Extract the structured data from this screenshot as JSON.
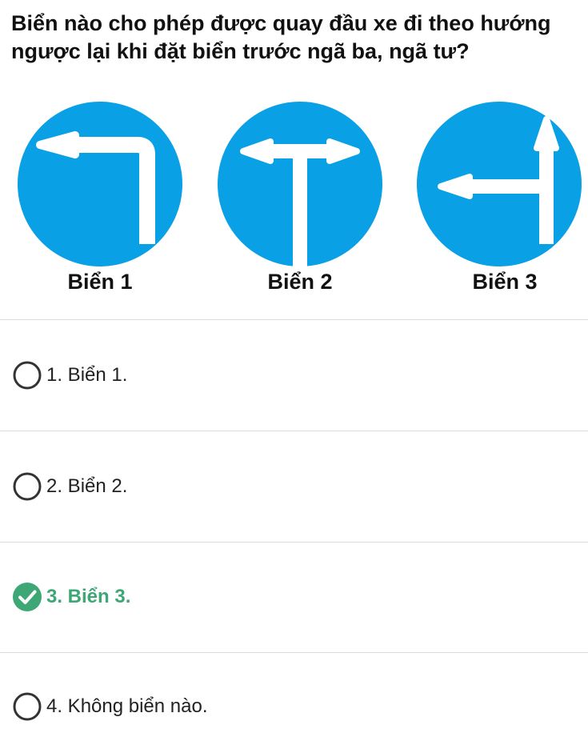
{
  "question": {
    "text": "Biển nào cho phép được quay đầu xe đi theo hướng ngược lại khi đặt biển trước ngã ba, ngã tư?"
  },
  "signs": [
    {
      "caption": "Biển 1",
      "icon": "turn-left-arrow-sign-icon"
    },
    {
      "caption": "Biển 2",
      "icon": "left-right-arrow-sign-icon"
    },
    {
      "caption": "Biển 3",
      "icon": "straight-or-left-arrow-sign-icon"
    }
  ],
  "answers": [
    {
      "label": "1. Biển 1.",
      "state": "unselected"
    },
    {
      "label": "2. Biển 2.",
      "state": "unselected"
    },
    {
      "label": "3. Biển 3.",
      "state": "correct"
    },
    {
      "label": "4. Không biển nào.",
      "state": "unselected"
    }
  ],
  "colors": {
    "sign_blue": "#0aa0e6",
    "correct_green": "#3da776",
    "radio_border": "#333333",
    "divider": "#dcdcdc"
  }
}
